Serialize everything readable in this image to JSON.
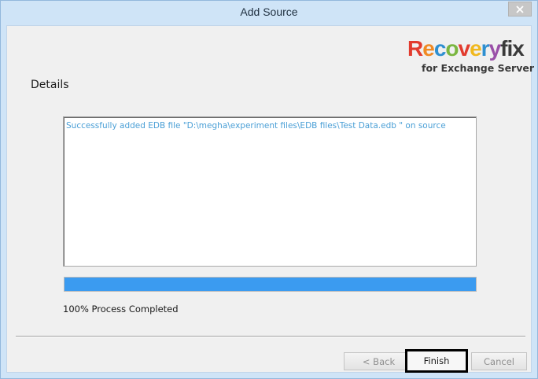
{
  "window": {
    "title": "Add Source",
    "close_icon": "close-icon"
  },
  "logo": {
    "letters": [
      {
        "ch": "R",
        "color": "#e23b2e"
      },
      {
        "ch": "e",
        "color": "#f08a24"
      },
      {
        "ch": "c",
        "color": "#2e8fd0"
      },
      {
        "ch": "o",
        "color": "#7ab640"
      },
      {
        "ch": "v",
        "color": "#e23b2e"
      },
      {
        "ch": "e",
        "color": "#f0b81e"
      },
      {
        "ch": "r",
        "color": "#2e8fd0"
      },
      {
        "ch": "y",
        "color": "#9a4fa8"
      },
      {
        "ch": "f",
        "color": "#3a3a3a"
      },
      {
        "ch": "i",
        "color": "#3a3a3a"
      },
      {
        "ch": "x",
        "color": "#3a3a3a"
      }
    ],
    "subtitle": "for Exchange Server"
  },
  "details": {
    "label": "Details",
    "log_lines": [
      "Successfully added EDB file \"D:\\megha\\experiment files\\EDB files\\Test Data.edb \" on source"
    ]
  },
  "progress": {
    "value_percent": 100,
    "label": "100% Process Completed",
    "color": "#3b9bf0"
  },
  "buttons": {
    "back": "< Back",
    "finish": "Finish",
    "cancel": "Cancel"
  }
}
